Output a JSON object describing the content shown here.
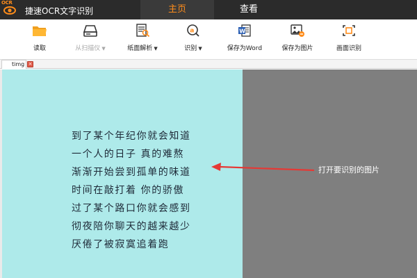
{
  "app": {
    "logo_text": "OCR",
    "title": "捷速OCR文字识别"
  },
  "main_tabs": [
    {
      "label": "主页",
      "active": true
    },
    {
      "label": "查看",
      "active": false
    }
  ],
  "toolbar": {
    "read": {
      "label": "读取",
      "icon": "folder-icon",
      "enabled": true
    },
    "scanner": {
      "label": "从扫描仪",
      "icon": "scanner-icon",
      "enabled": false,
      "has_dropdown": true
    },
    "layout": {
      "label": "纸面解析",
      "icon": "page-analysis-icon",
      "enabled": true,
      "has_dropdown": true
    },
    "recognize": {
      "label": "识别",
      "icon": "ocr-recognize-icon",
      "enabled": true,
      "has_dropdown": true
    },
    "save_word": {
      "label": "保存为Word",
      "icon": "word-doc-icon",
      "enabled": true
    },
    "save_image": {
      "label": "保存为图片",
      "icon": "save-image-icon",
      "enabled": true
    },
    "screen_ocr": {
      "label": "画面识别",
      "icon": "screen-capture-icon",
      "enabled": true
    },
    "caret": "▼"
  },
  "document_tab": {
    "label": "timg",
    "close_glyph": "×"
  },
  "image_text": [
    "到了某个年纪你就会知道",
    "一个人的日子 真的难熬",
    "渐渐开始尝到孤单的味道",
    "时间在敲打着 你的骄傲",
    "过了某个路口你就会感到",
    "彻夜陪你聊天的越来越少",
    "厌倦了被寂寞追着跑"
  ],
  "annotation": {
    "text": "打开要识别的图片"
  },
  "colors": {
    "accent": "#ff8c1a",
    "titlebar": "#2b2b2b",
    "image_background": "#aeeaea",
    "right_pane": "#7f7f7f",
    "arrow": "#e53935"
  }
}
